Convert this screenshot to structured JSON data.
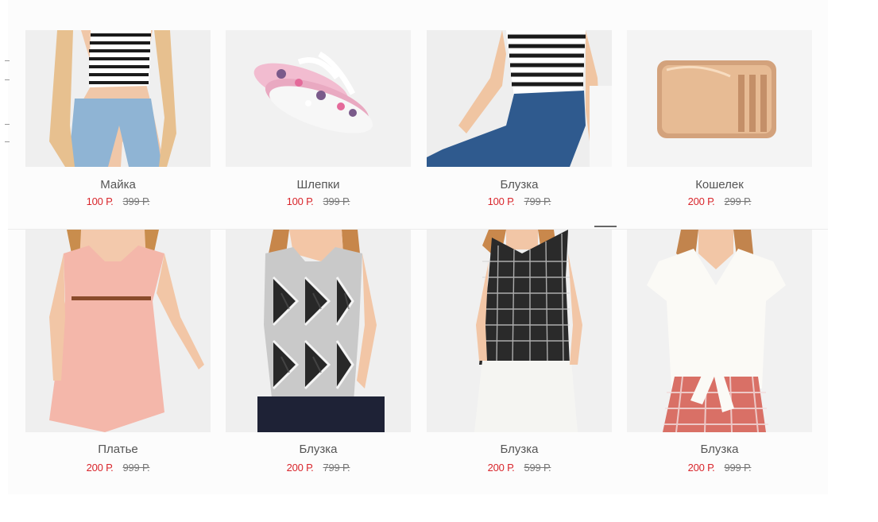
{
  "products": [
    {
      "name": "Майка",
      "price": "100 Р.",
      "old_price": "399 Р.",
      "image": "woman-in-striped-crop-top-and-jeans"
    },
    {
      "name": "Шлепки",
      "price": "100 Р.",
      "old_price": "399 Р.",
      "image": "pink-printed-flip-flops"
    },
    {
      "name": "Блузка",
      "price": "100 Р.",
      "old_price": "799 Р.",
      "image": "woman-in-striped-top-and-blue-jeans"
    },
    {
      "name": "Кошелек",
      "price": "200 Р.",
      "old_price": "299 Р.",
      "image": "rose-gold-card-wallet"
    },
    {
      "name": "Платье",
      "price": "200 Р.",
      "old_price": "999 Р.",
      "image": "woman-in-pink-sleeveless-dress"
    },
    {
      "name": "Блузка",
      "price": "200 Р.",
      "old_price": "799 Р.",
      "image": "woman-in-geometric-print-sleeveless-blouse"
    },
    {
      "name": "Блузка",
      "price": "200 Р.",
      "old_price": "599 Р.",
      "image": "woman-in-black-white-check-sleeveless-top"
    },
    {
      "name": "Блузка",
      "price": "200 Р.",
      "old_price": "999 Р.",
      "image": "woman-in-white-blouse-and-plaid-skirt"
    }
  ],
  "colors": {
    "sale_price": "#d9262c",
    "old_price": "#777777",
    "background": "#ffffff",
    "panel": "#fcfcfc"
  }
}
